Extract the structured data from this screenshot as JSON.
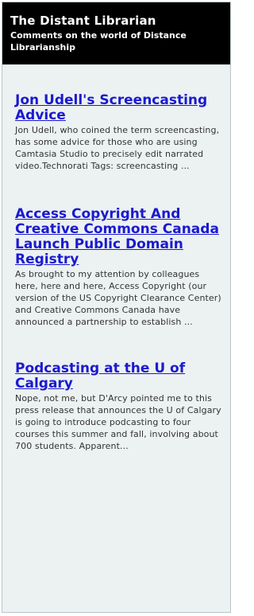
{
  "blog": {
    "title": "The Distant Librarian",
    "description": "Comments on the world of Distance Librarianship"
  },
  "posts": [
    {
      "title": "Jon Udell's Screencasting Advice",
      "excerpt": "Jon Udell, who coined the term screencasting, has some advice for those who are using Camtasia Studio to precisely edit narrated video.Technorati Tags: screencasting ..."
    },
    {
      "title": "Access Copyright And Creative Commons Canada Launch Public Domain Registry",
      "excerpt": "As brought to my attention by colleagues here, here and here, Access Copyright (our version of the US Copyright Clearance Center) and Creative Commons Canada have announced a partnership to establish ..."
    },
    {
      "title": "Podcasting at the U of Calgary",
      "excerpt": "Nope, not me, but D'Arcy pointed me to this press release that announces the U of Calgary is going to introduce podcasting to four courses this summer and fall, involving about 700 students.  Apparent..."
    }
  ],
  "colors": {
    "link": "#1a1ad0",
    "header_bg": "#000000",
    "panel_bg": "#ecf1f2"
  }
}
